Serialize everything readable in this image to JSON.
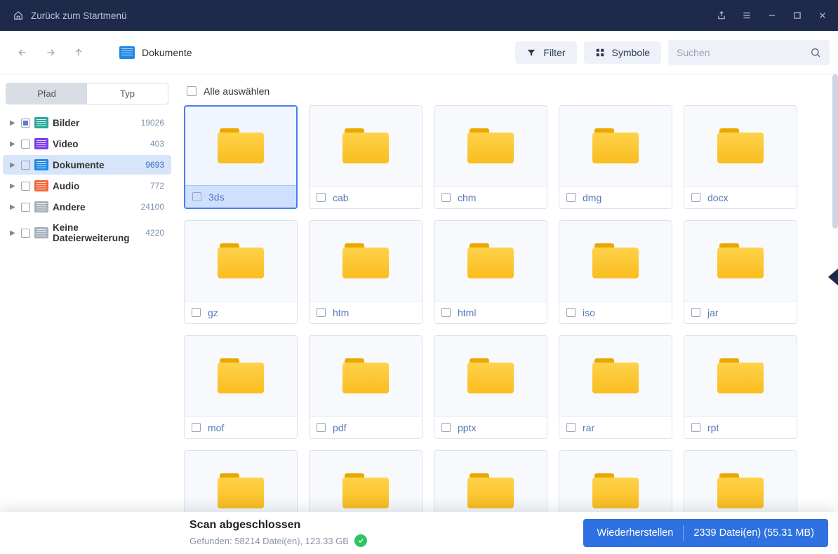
{
  "titlebar": {
    "home": "Zurück zum Startmenü"
  },
  "toolbar": {
    "breadcrumb": "Dokumente",
    "filter": "Filter",
    "symbols": "Symbole",
    "search_placeholder": "Suchen"
  },
  "sidebar": {
    "tab_pfad": "Pfad",
    "tab_typ": "Typ",
    "items": [
      {
        "label": "Bilder",
        "count": "19026",
        "color": "green",
        "partial": true
      },
      {
        "label": "Video",
        "count": "403",
        "color": "purple",
        "partial": false
      },
      {
        "label": "Dokumente",
        "count": "9693",
        "color": "blue",
        "partial": false,
        "selected": true
      },
      {
        "label": "Audio",
        "count": "772",
        "color": "orange",
        "partial": false
      },
      {
        "label": "Andere",
        "count": "24100",
        "color": "gray",
        "partial": false
      },
      {
        "label": "Keine Dateierweiterung",
        "count": "4220",
        "color": "gray",
        "partial": false
      }
    ]
  },
  "content": {
    "select_all": "Alle auswählen",
    "folders": [
      {
        "name": "3ds",
        "selected": true
      },
      {
        "name": "cab"
      },
      {
        "name": "chm"
      },
      {
        "name": "dmg"
      },
      {
        "name": "docx"
      },
      {
        "name": "gz"
      },
      {
        "name": "htm"
      },
      {
        "name": "html"
      },
      {
        "name": "iso"
      },
      {
        "name": "jar"
      },
      {
        "name": "mof"
      },
      {
        "name": "pdf"
      },
      {
        "name": "pptx"
      },
      {
        "name": "rar"
      },
      {
        "name": "rpt"
      },
      {
        "name": ""
      },
      {
        "name": ""
      },
      {
        "name": ""
      },
      {
        "name": ""
      },
      {
        "name": ""
      }
    ]
  },
  "footer": {
    "title": "Scan abgeschlossen",
    "subtitle": "Gefunden: 58214 Datei(en), 123.33 GB",
    "recover": "Wiederherstellen",
    "recover_count": "2339 Datei(en) (55.31 MB)"
  }
}
